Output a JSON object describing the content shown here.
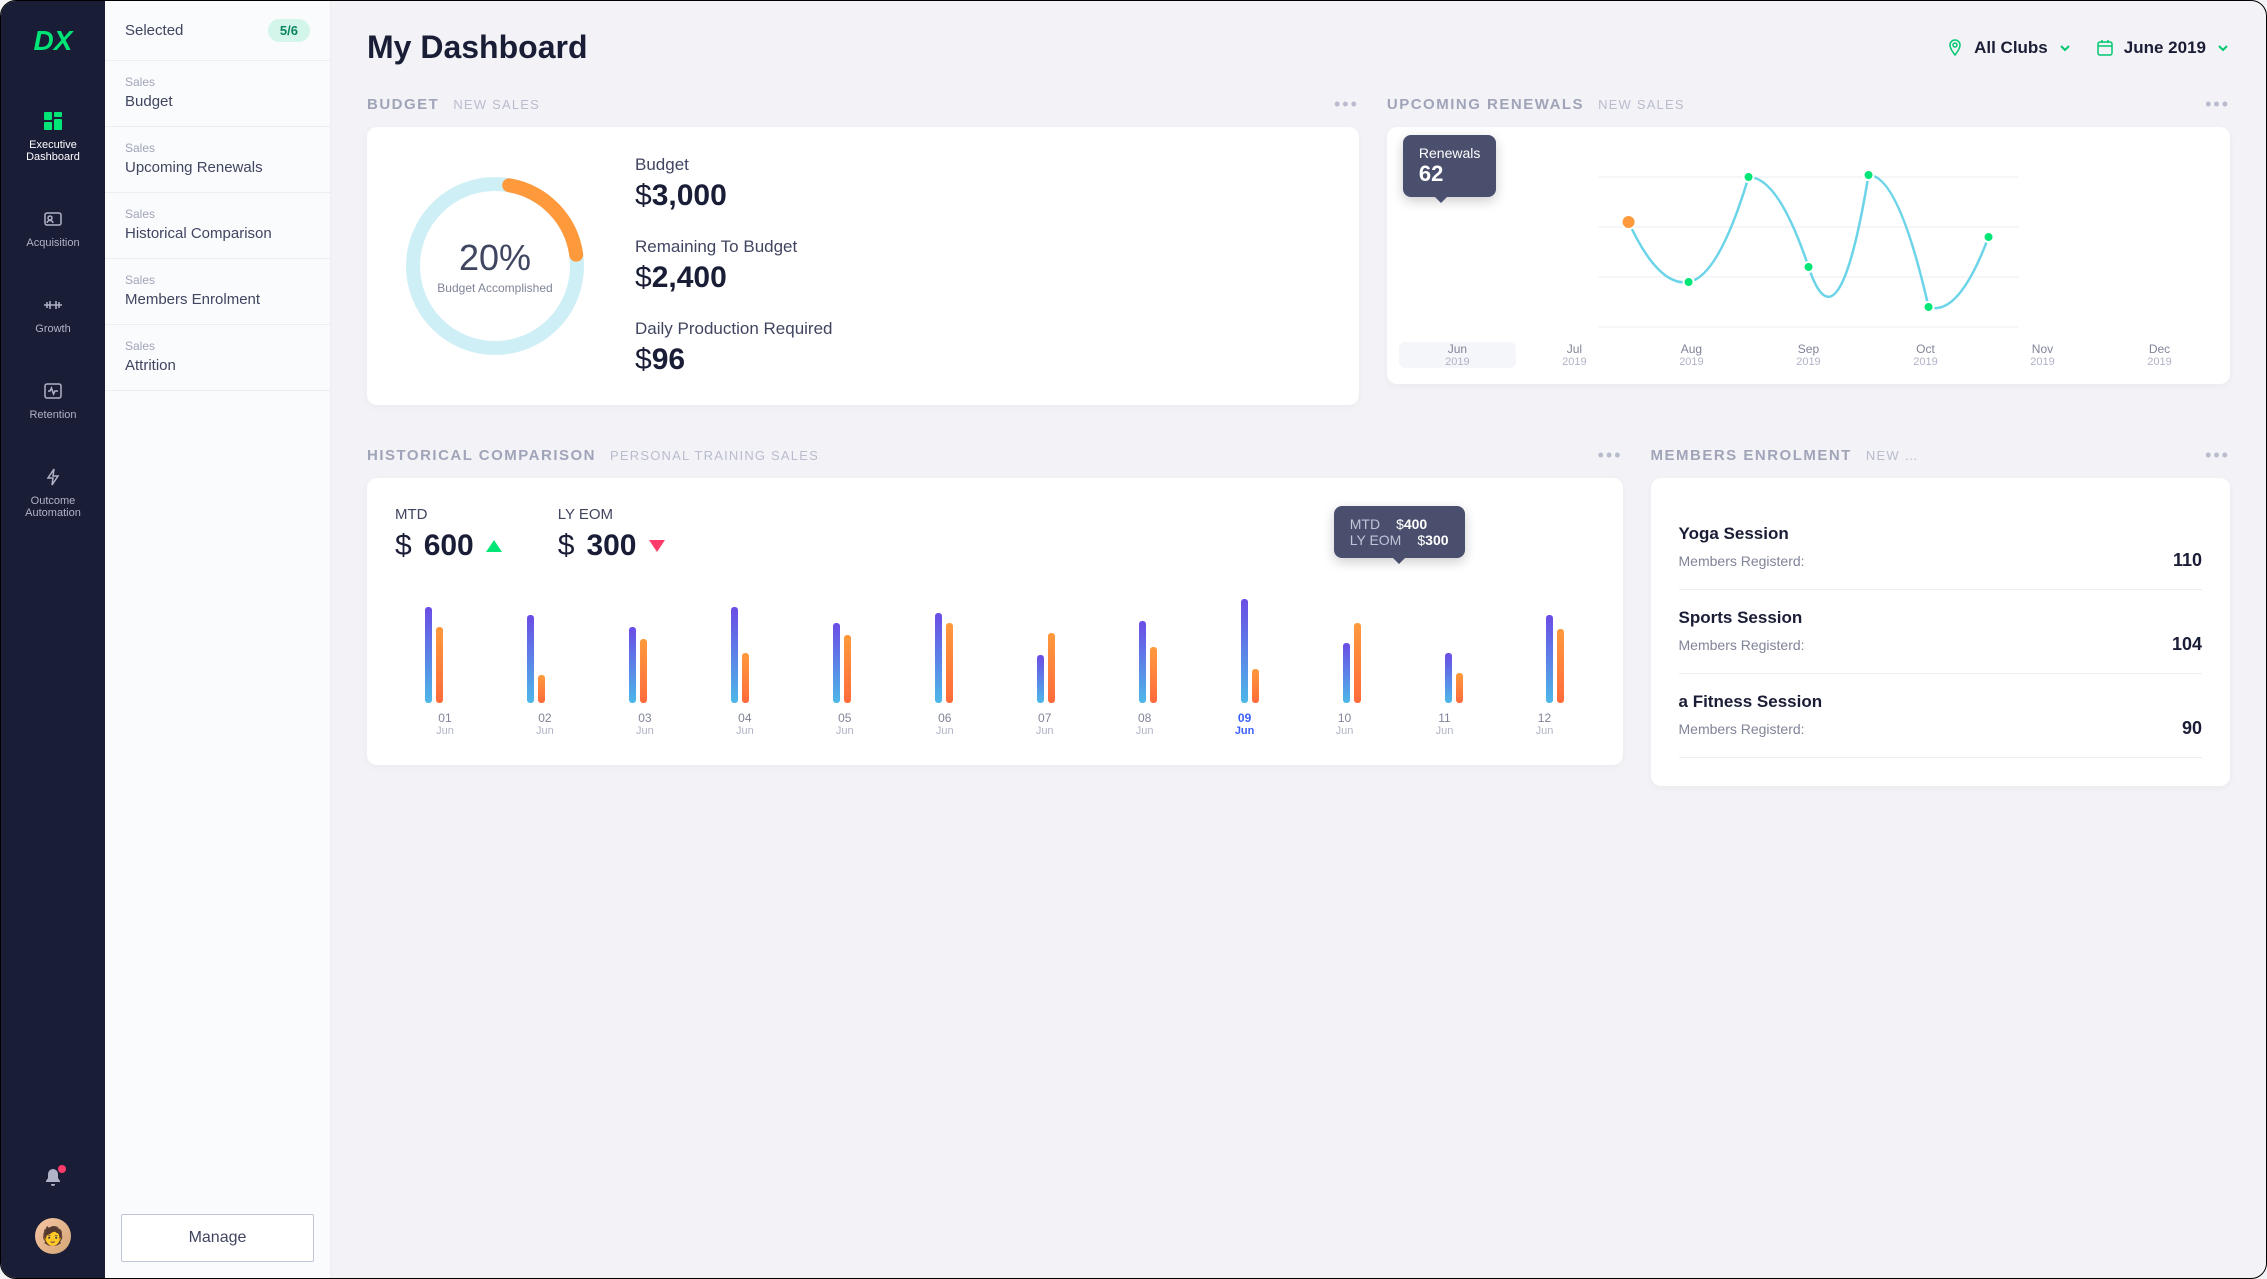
{
  "colors": {
    "accent": "#00e676",
    "dark": "#1a1d36",
    "orange": "#ff9a3c",
    "cyan": "#4db8e8",
    "purple": "#6b4ce6",
    "pink": "#ff3b6b"
  },
  "nav": [
    {
      "label": "Executive Dashboard",
      "icon": "grid-icon",
      "active": true
    },
    {
      "label": "Acquisition",
      "icon": "id-icon",
      "active": false
    },
    {
      "label": "Growth",
      "icon": "barbell-icon",
      "active": false
    },
    {
      "label": "Retention",
      "icon": "pulse-icon",
      "active": false
    },
    {
      "label": "Outcome Automation",
      "icon": "bolt-icon",
      "active": false
    }
  ],
  "sidebar": {
    "selected_label": "Selected",
    "selected_count": "5/6",
    "items": [
      {
        "category": "Sales",
        "name": "Budget"
      },
      {
        "category": "Sales",
        "name": "Upcoming Renewals"
      },
      {
        "category": "Sales",
        "name": "Historical Comparison"
      },
      {
        "category": "Sales",
        "name": "Members Enrolment"
      },
      {
        "category": "Sales",
        "name": "Attrition"
      }
    ],
    "manage_label": "Manage"
  },
  "header": {
    "title": "My Dashboard",
    "club_filter": "All Clubs",
    "date_filter": "June 2019"
  },
  "budget": {
    "title": "BUDGET",
    "subtitle": "NEW SALES",
    "pct": "20%",
    "pct_label": "Budget Accomplished",
    "stats": [
      {
        "label": "Budget",
        "value": "3,000"
      },
      {
        "label": "Remaining To Budget",
        "value": "2,400"
      },
      {
        "label": "Daily Production Required",
        "value": "96"
      }
    ]
  },
  "renewals": {
    "title": "UPCOMING RENEWALS",
    "subtitle": "NEW SALES",
    "tooltip_label": "Renewals",
    "tooltip_value": "62",
    "xaxis": [
      {
        "m": "Jun",
        "y": "2019",
        "active": true
      },
      {
        "m": "Jul",
        "y": "2019"
      },
      {
        "m": "Aug",
        "y": "2019"
      },
      {
        "m": "Sep",
        "y": "2019"
      },
      {
        "m": "Oct",
        "y": "2019"
      },
      {
        "m": "Nov",
        "y": "2019"
      },
      {
        "m": "Dec",
        "y": "2019"
      }
    ]
  },
  "historical": {
    "title": "HISTORICAL COMPARISON",
    "subtitle": "PERSONAL TRAINING SALES",
    "mtd_label": "MTD",
    "mtd_value": "600",
    "lyeom_label": "LY EOM",
    "lyeom_value": "300",
    "tooltip": {
      "mtd_k": "MTD",
      "mtd_v": "400",
      "ly_k": "LY EOM",
      "ly_v": "300"
    },
    "xaxis": [
      {
        "d": "01",
        "m": "Jun"
      },
      {
        "d": "02",
        "m": "Jun"
      },
      {
        "d": "03",
        "m": "Jun"
      },
      {
        "d": "04",
        "m": "Jun"
      },
      {
        "d": "05",
        "m": "Jun"
      },
      {
        "d": "06",
        "m": "Jun"
      },
      {
        "d": "07",
        "m": "Jun"
      },
      {
        "d": "08",
        "m": "Jun"
      },
      {
        "d": "09",
        "m": "Jun",
        "hl": true
      },
      {
        "d": "10",
        "m": "Jun"
      },
      {
        "d": "11",
        "m": "Jun"
      },
      {
        "d": "12",
        "m": "Jun"
      }
    ]
  },
  "enrolment": {
    "title": "MEMBERS ENROLMENT",
    "subtitle": "NEW S...",
    "registered_label": "Members Registerd:",
    "items": [
      {
        "name": "Yoga Session",
        "count": "110"
      },
      {
        "name": "Sports Session",
        "count": "104"
      },
      {
        "name": "a Fitness Session",
        "count": "90"
      }
    ]
  },
  "chart_data": [
    {
      "type": "donut",
      "title": "Budget Accomplished",
      "value_pct": 20,
      "track_color": "#cfeff6",
      "arc_color": "#ff9a3c"
    },
    {
      "type": "line",
      "title": "Upcoming Renewals",
      "categories": [
        "Jun 2019",
        "Jul 2019",
        "Aug 2019",
        "Sep 2019",
        "Oct 2019",
        "Nov 2019",
        "Dec 2019"
      ],
      "values": [
        62,
        30,
        80,
        35,
        82,
        18,
        55
      ],
      "highlight_index": 0,
      "highlight_value": 62,
      "ylim": [
        0,
        100
      ]
    },
    {
      "type": "bar",
      "title": "Historical Comparison – Personal Training Sales",
      "categories": [
        "01 Jun",
        "02 Jun",
        "03 Jun",
        "04 Jun",
        "05 Jun",
        "06 Jun",
        "07 Jun",
        "08 Jun",
        "09 Jun",
        "10 Jun",
        "11 Jun",
        "12 Jun"
      ],
      "series": [
        {
          "name": "MTD",
          "values": [
            480,
            440,
            380,
            480,
            400,
            450,
            240,
            410,
            520,
            300,
            250,
            440
          ]
        },
        {
          "name": "LY EOM",
          "values": [
            380,
            140,
            320,
            250,
            340,
            400,
            350,
            280,
            170,
            400,
            150,
            370
          ]
        }
      ],
      "highlight_index": 8,
      "tooltip": {
        "MTD": 400,
        "LY EOM": 300
      },
      "summary": {
        "MTD": 600,
        "LY EOM": 300
      },
      "ylim": [
        0,
        600
      ]
    }
  ]
}
